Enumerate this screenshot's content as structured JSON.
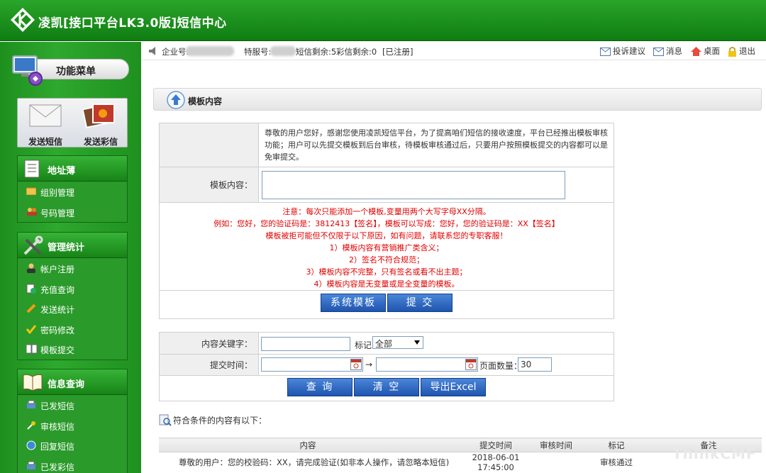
{
  "header": {
    "title": "凌凯[接口平台LK3.0版]短信中心"
  },
  "sidebar": {
    "menu_title": "功能菜单",
    "quick": [
      {
        "label": "发送短信",
        "icon": "envelope-icon"
      },
      {
        "label": "发送彩信",
        "icon": "photo-icon"
      }
    ],
    "sections": [
      {
        "title": "地址薄",
        "icon": "address-book-icon",
        "items": [
          {
            "label": "组别管理",
            "icon": "folder-icon"
          },
          {
            "label": "号码管理",
            "icon": "users-icon"
          }
        ]
      },
      {
        "title": "管理统计",
        "icon": "tools-icon",
        "items": [
          {
            "label": "帐户注册",
            "icon": "user-icon"
          },
          {
            "label": "充值查询",
            "icon": "recharge-icon"
          },
          {
            "label": "发送统计",
            "icon": "pencil-icon"
          },
          {
            "label": "密码修改",
            "icon": "check-icon"
          },
          {
            "label": "模板提交",
            "icon": "book-icon"
          }
        ]
      },
      {
        "title": "信息查询",
        "icon": "book-open-icon",
        "items": [
          {
            "label": "已发短信",
            "icon": "print-icon"
          },
          {
            "label": "审核短信",
            "icon": "key-icon"
          },
          {
            "label": "回复短信",
            "icon": "globe-icon"
          },
          {
            "label": "已发彩信",
            "icon": "print-icon"
          }
        ]
      }
    ]
  },
  "topbar": {
    "enterprise_label": "企业号:",
    "service_label": "特服号:",
    "sms_left": "短信剩余:5",
    "mms_left": "彩信剩余:0",
    "registered": "[已注册]",
    "links": [
      {
        "label": "投诉建议",
        "icon": "mail-icon"
      },
      {
        "label": "消息",
        "icon": "mail-icon"
      },
      {
        "label": "桌面",
        "icon": "home-icon"
      },
      {
        "label": "退出",
        "icon": "lock-icon"
      }
    ]
  },
  "main": {
    "section_title": "模板内容",
    "notice": "尊敬的用户您好，感谢您使用凌凯短信平台，为了提高咱们短信的接收速度，平台已经推出模板审核功能；用户可以先提交模板到后台审核，待模板审核通过后，只要用户按照模板提交的内容都可以是免审提交。",
    "template_label": "模板内容：",
    "template_value": "",
    "rules": [
      "注意：每次只能添加一个模板,变量用两个大写字母XX分隔。",
      "例如：您好，您的验证码是：3812413【签名】，模板可以写成：您好，您的验证码是：XX【签名】",
      "模板被拒可能但不仅限于以下原因，如有问题，请联系您的专职客服！",
      "1）模板内容有营销推广类含义；",
      "2）签名不符合规范；",
      "3）模板内容不完整，只有签名或看不出主题；",
      "4）模板内容是无变量或是全变量的模板。"
    ],
    "btn_system": "系统模板",
    "btn_submit": "提  交",
    "search": {
      "keyword_label": "内容关键字：",
      "keyword_value": "",
      "mark_label": "标记:",
      "mark_value": "全部",
      "time_label": "提交时间：",
      "start_value": "",
      "end_value": "",
      "arrow": "→",
      "page_size_label": "页面数量：",
      "page_size_value": "30",
      "btn_query": "查  询",
      "btn_clear": "清  空",
      "btn_export": "导出Excel"
    },
    "result_label": "符合条件的内容有以下：",
    "grid": {
      "columns": [
        "内容",
        "提交时间",
        "审核时间",
        "标记",
        "备注"
      ],
      "rows": [
        {
          "content": "尊敬的用户：您的校验码：XX，请完成验证(如非本人操作，请忽略本短信)",
          "submit_time": "2018-06-01 17:45:00",
          "review_time": "",
          "mark": "审核通过",
          "note": ""
        }
      ]
    },
    "watermark": "ThinkCMF"
  }
}
